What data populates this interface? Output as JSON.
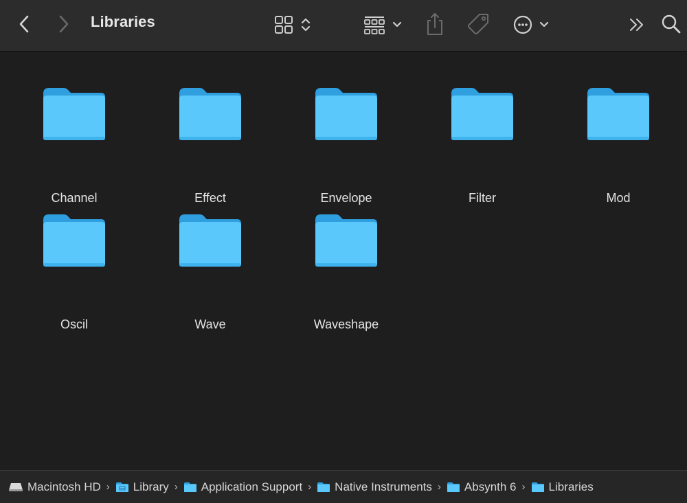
{
  "window": {
    "title": "Libraries"
  },
  "toolbar": {
    "back_icon": "chevron-left-icon",
    "forward_icon": "chevron-right-icon",
    "view_icon": "grid-view-icon",
    "group_icon": "group-by-icon",
    "share_icon": "share-icon",
    "tag_icon": "tag-icon",
    "action_icon": "ellipsis-circle-icon",
    "more_icon": "double-chevron-right-icon",
    "search_icon": "search-icon"
  },
  "folders": [
    {
      "name": "Channel"
    },
    {
      "name": "Effect"
    },
    {
      "name": "Envelope"
    },
    {
      "name": "Filter"
    },
    {
      "name": "Mod"
    },
    {
      "name": "Oscil"
    },
    {
      "name": "Wave"
    },
    {
      "name": "Waveshape"
    }
  ],
  "pathbar": {
    "separator": "›",
    "items": [
      {
        "label": "Macintosh HD",
        "icon": "hard-drive-icon"
      },
      {
        "label": "Library",
        "icon": "library-folder-icon"
      },
      {
        "label": "Application Support",
        "icon": "folder-icon"
      },
      {
        "label": "Native Instruments",
        "icon": "folder-icon"
      },
      {
        "label": "Absynth 6",
        "icon": "folder-icon"
      },
      {
        "label": "Libraries",
        "icon": "folder-icon"
      }
    ]
  },
  "colors": {
    "background": "#1e1e1e",
    "toolbar": "#2c2c2c",
    "folder_body": "#5ac8fa",
    "folder_back": "#2f9fe0",
    "text": "#e6e6e6"
  }
}
